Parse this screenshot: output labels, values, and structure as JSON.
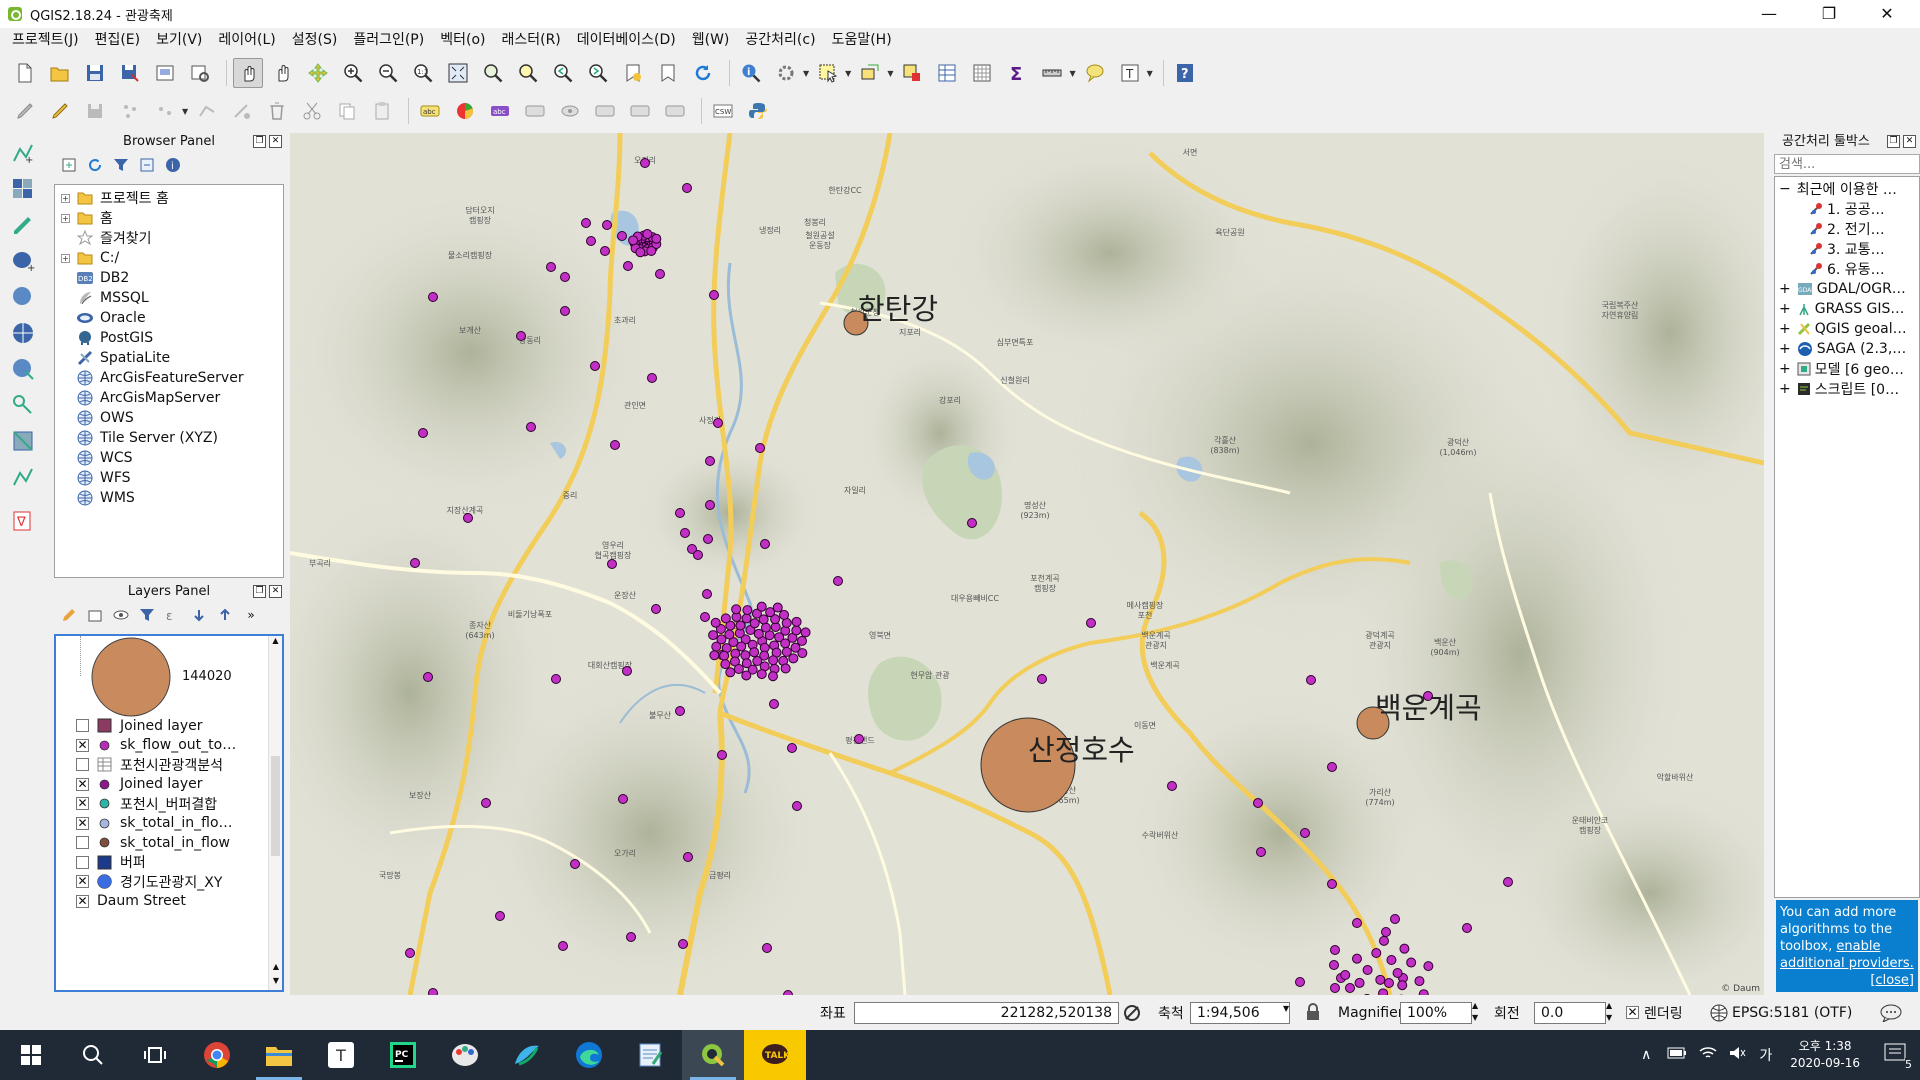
{
  "window": {
    "title": "QGIS2.18.24 - 관광축제",
    "minimize": "—",
    "restore": "❐",
    "close": "✕"
  },
  "menu": [
    "프로젝트(J)",
    "편집(E)",
    "보기(V)",
    "레이어(L)",
    "설정(S)",
    "플러그인(P)",
    "벡터(o)",
    "래스터(R)",
    "데이터베이스(D)",
    "웹(W)",
    "공간처리(c)",
    "도움말(H)"
  ],
  "toolbar_icons": {
    "row1": [
      "new-project",
      "open-project",
      "save-project",
      "save-as",
      "print-composer",
      "composer-manager",
      "pan-to-selection",
      "pan",
      "pan-map",
      "zoom-in",
      "zoom-out",
      "zoom-actual",
      "zoom-full",
      "zoom-layer",
      "zoom-selection",
      "zoom-last",
      "zoom-next",
      "new-bookmark",
      "show-bookmarks",
      "refresh",
      "identify",
      "run-action",
      "select",
      "select-value",
      "deselect",
      "attribute-table",
      "field-calculator",
      "statistics",
      "measure",
      "map-tips",
      "text-annotation",
      "help"
    ],
    "row2": [
      "current-edits",
      "toggle-edit",
      "save-edits",
      "add-feature",
      "move-feature",
      "node-tool",
      "delete-selected",
      "cut",
      "copy",
      "paste",
      "label-tool",
      "diagram",
      "highlight-pinned",
      "move-label",
      "show-hide-label",
      "preview-label",
      "rotate-label",
      "change-label",
      "csw",
      "python"
    ]
  },
  "browser_panel": {
    "title": "Browser Panel",
    "items": [
      {
        "label": "프로젝트 홈",
        "icon": "folder-icon",
        "expandable": true
      },
      {
        "label": "홈",
        "icon": "folder-icon",
        "expandable": true
      },
      {
        "label": "즐겨찾기",
        "icon": "star-icon",
        "expandable": false
      },
      {
        "label": "C:/",
        "icon": "folder-icon",
        "expandable": true
      },
      {
        "label": "DB2",
        "icon": "db2-icon",
        "expandable": false
      },
      {
        "label": "MSSQL",
        "icon": "mssql-icon",
        "expandable": false
      },
      {
        "label": "Oracle",
        "icon": "oracle-icon",
        "expandable": false
      },
      {
        "label": "PostGIS",
        "icon": "postgis-icon",
        "expandable": false
      },
      {
        "label": "SpatiaLite",
        "icon": "spatialite-icon",
        "expandable": false
      },
      {
        "label": "ArcGisFeatureServer",
        "icon": "globe-icon",
        "expandable": false
      },
      {
        "label": "ArcGisMapServer",
        "icon": "globe-icon",
        "expandable": false
      },
      {
        "label": "OWS",
        "icon": "globe-icon",
        "expandable": false
      },
      {
        "label": "Tile Server (XYZ)",
        "icon": "globe-icon",
        "expandable": false
      },
      {
        "label": "WCS",
        "icon": "globe-icon",
        "expandable": false
      },
      {
        "label": "WFS",
        "icon": "globe-icon",
        "expandable": false
      },
      {
        "label": "WMS",
        "icon": "globe-icon",
        "expandable": false
      }
    ]
  },
  "layers_panel": {
    "title": "Layers Panel",
    "legend_value": "144020",
    "layers": [
      {
        "label": "Joined layer",
        "checked": false,
        "symbol": "square",
        "color": "#8b3a62"
      },
      {
        "label": "sk_flow_out_to…",
        "checked": true,
        "symbol": "dot",
        "color": "#b62bb8"
      },
      {
        "label": "포천시관광객분석",
        "checked": false,
        "symbol": "table",
        "color": "#888888"
      },
      {
        "label": "Joined layer",
        "checked": true,
        "symbol": "dot",
        "color": "#8d1a8d"
      },
      {
        "label": "포천시_버퍼결합",
        "checked": true,
        "symbol": "dot",
        "color": "#2fb5a7"
      },
      {
        "label": "sk_total_in_flo…",
        "checked": true,
        "symbol": "dot",
        "color": "#a6b6e0"
      },
      {
        "label": "sk_total_in_flow",
        "checked": false,
        "symbol": "dot",
        "color": "#7e4f3a"
      },
      {
        "label": "버퍼",
        "checked": false,
        "symbol": "square",
        "color": "#1b3a8c"
      },
      {
        "label": "경기도관광지_XY",
        "checked": true,
        "symbol": "bigdot",
        "color": "#3b6de0"
      },
      {
        "label": "Daum Street",
        "checked": true,
        "symbol": "none",
        "color": ""
      }
    ]
  },
  "map": {
    "big_labels": [
      "한탄강",
      "산정호수",
      "백운계곡"
    ],
    "place_labels": [
      "오지리",
      "담터오지\n캠핑장",
      "물소리캠핑장",
      "청봉리",
      "냉정리",
      "한탄강CC",
      "철원공설\n운동장",
      "철원군청",
      "서면",
      "육단공원",
      "초과리",
      "상동리",
      "보개산",
      "지포리",
      "심부면특포",
      "국립복주산\n자연휴양림",
      "신철원리",
      "관인면",
      "사정리",
      "강포리",
      "각흘산\n(838m)",
      "광덕산\n(1,046m)",
      "중리",
      "자일리",
      "명성산\n(923m)",
      "지장산계곡",
      "포천계곡\n캠핑장",
      "부곡리",
      "영우리\n협곡캠핑장",
      "운장산",
      "대우용빼비CC",
      "메사캠핑장\n포천",
      "종자산\n(643m)",
      "비둘기낭폭포",
      "문암리",
      "백운계곡\n관광지",
      "광덕계곡\n관광지",
      "백운산\n(904m)",
      "대회산캠핑장",
      "영북면",
      "백운계곡",
      "현무암 관광",
      "이동면",
      "평강랜드",
      "불무산",
      "가리산\n(774m)",
      "사향산\n(665m)",
      "악할바위산",
      "보장산",
      "수락버위산",
      "운태비안코\n캠핑장",
      "오가리",
      "금평리",
      "국망봉"
    ],
    "attribution": "© Daum"
  },
  "status": {
    "coord_label": "좌표",
    "coord_value": "221282,520138",
    "scale_label": "축척",
    "scale_value": "1:94,506",
    "magnifier_label": "Magnifier",
    "magnifier_value": "100%",
    "rotation_label": "회전",
    "rotation_value": "0.0",
    "render_label": "렌더링",
    "crs": "EPSG:5181 (OTF)"
  },
  "processing": {
    "title": "공간처리 툴박스",
    "search_placeholder": "검색...",
    "tree": [
      {
        "label": "최근에 이용한 …",
        "level": 0,
        "expanded": true,
        "icon": "none"
      },
      {
        "label": "1. 공공…",
        "level": 1,
        "icon": "tool-icon"
      },
      {
        "label": "2. 전기…",
        "level": 1,
        "icon": "tool-icon"
      },
      {
        "label": "3. 교통…",
        "level": 1,
        "icon": "tool-icon"
      },
      {
        "label": "6. 유동…",
        "level": 1,
        "icon": "tool-icon"
      },
      {
        "label": "GDAL/OGR…",
        "level": 0,
        "expanded": false,
        "icon": "gdal-icon"
      },
      {
        "label": "GRASS GIS…",
        "level": 0,
        "expanded": false,
        "icon": "grass-icon"
      },
      {
        "label": "QGIS geoal…",
        "level": 0,
        "expanded": false,
        "icon": "qgis-icon"
      },
      {
        "label": "SAGA (2.3,…",
        "level": 0,
        "expanded": false,
        "icon": "saga-icon"
      },
      {
        "label": "모델 [6 geo…",
        "level": 0,
        "expanded": false,
        "icon": "model-icon"
      },
      {
        "label": "스크립트 [0…",
        "level": 0,
        "expanded": false,
        "icon": "script-icon"
      }
    ],
    "info_text": "You can add more algorithms to the toolbox,",
    "info_link": "enable additional providers.",
    "info_close": "[close]"
  },
  "taskbar": {
    "apps": [
      "start",
      "search",
      "task-view",
      "chrome",
      "explorer",
      "typora",
      "pycharm",
      "paint",
      "app-blue",
      "edge",
      "notepad",
      "qgis",
      "kakaotalk"
    ],
    "ime": "가",
    "time": "오후 1:38",
    "date": "2020-09-16",
    "notifications": "5"
  }
}
